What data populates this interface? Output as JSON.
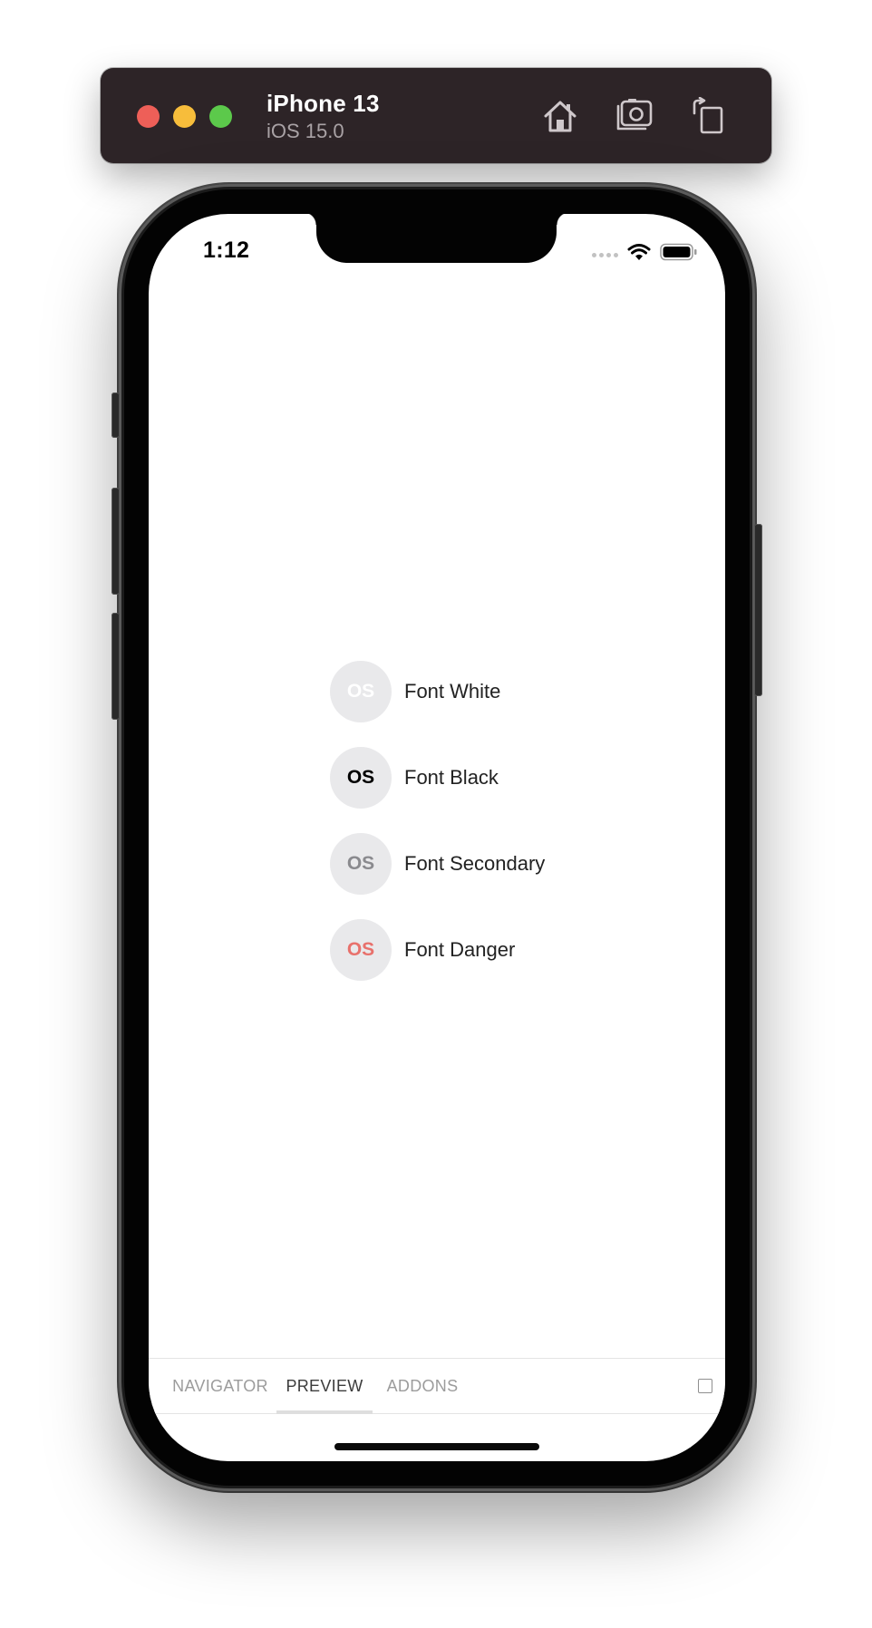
{
  "simulator": {
    "device_name": "iPhone 13",
    "os_version": "iOS 15.0",
    "buttons": [
      {
        "name": "home-icon"
      },
      {
        "name": "screenshot-icon"
      },
      {
        "name": "rotate-icon"
      }
    ],
    "window_controls": {
      "close_color": "#ee5f58",
      "minimize_color": "#f7bd3b",
      "zoom_color": "#5cc94b"
    }
  },
  "status_bar": {
    "time": "1:12"
  },
  "font_list": [
    {
      "badge": "OS",
      "label": "Font White",
      "color": "#ffffff"
    },
    {
      "badge": "OS",
      "label": "Font Black",
      "color": "#000000"
    },
    {
      "badge": "OS",
      "label": "Font Secondary",
      "color": "#8a8a8e"
    },
    {
      "badge": "OS",
      "label": "Font Danger",
      "color": "#e8716c"
    }
  ],
  "tabs": {
    "navigator": "NAVIGATOR",
    "preview": "PREVIEW",
    "addons": "ADDONS",
    "active": "PREVIEW"
  }
}
